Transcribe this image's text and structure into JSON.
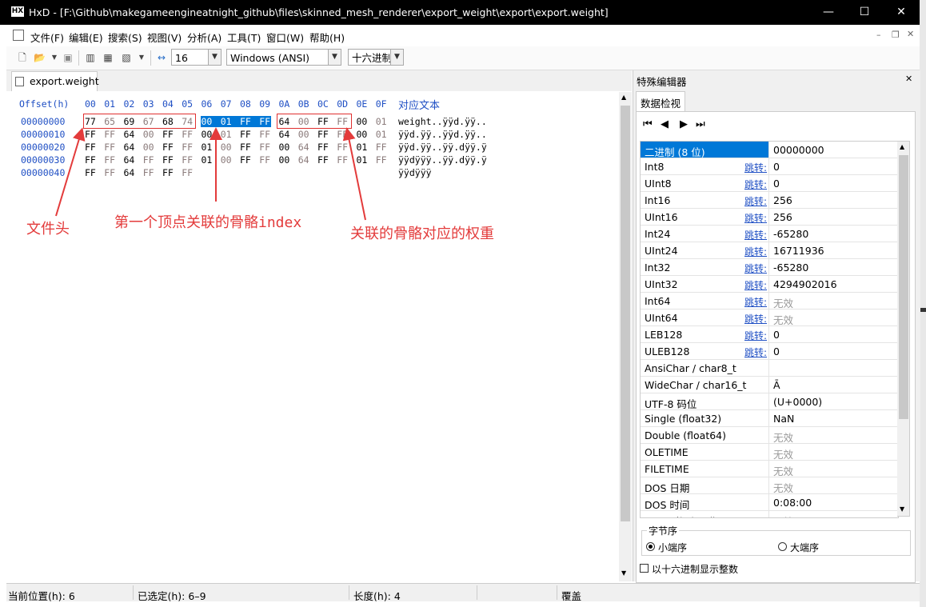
{
  "window": {
    "title": "HxD - [F:\\Github\\makegameengineatnight_github\\files\\skinned_mesh_renderer\\export_weight\\export\\export.weight]",
    "controls": [
      "minimize-icon",
      "maximize-icon",
      "close-icon"
    ]
  },
  "menu": {
    "items": [
      "文件(F)",
      "编辑(E)",
      "搜索(S)",
      "视图(V)",
      "分析(A)",
      "工具(T)",
      "窗口(W)",
      "帮助(H)"
    ]
  },
  "toolbar": {
    "bytes_per_row": "16",
    "charset": "Windows (ANSI)",
    "offset_base": "十六进制"
  },
  "tab": {
    "label": "export.weight"
  },
  "hex": {
    "header_offset": "Offset(h)",
    "columns": [
      "00",
      "01",
      "02",
      "03",
      "04",
      "05",
      "06",
      "07",
      "08",
      "09",
      "0A",
      "0B",
      "0C",
      "0D",
      "0E",
      "0F"
    ],
    "header_text": "对应文本",
    "rows": [
      {
        "offset": "00000000",
        "bytes": [
          "77",
          "65",
          "69",
          "67",
          "68",
          "74",
          "00",
          "01",
          "FF",
          "FF",
          "64",
          "00",
          "FF",
          "FF",
          "00",
          "01"
        ],
        "text": "weight..ÿÿd.ÿÿ.."
      },
      {
        "offset": "00000010",
        "bytes": [
          "FF",
          "FF",
          "64",
          "00",
          "FF",
          "FF",
          "00",
          "01",
          "FF",
          "FF",
          "64",
          "00",
          "FF",
          "FF",
          "00",
          "01"
        ],
        "text": "ÿÿd.ÿÿ..ÿÿd.ÿÿ.."
      },
      {
        "offset": "00000020",
        "bytes": [
          "FF",
          "FF",
          "64",
          "00",
          "FF",
          "FF",
          "01",
          "00",
          "FF",
          "FF",
          "00",
          "64",
          "FF",
          "FF",
          "01",
          "FF"
        ],
        "text": "ÿÿd.ÿÿ..ÿÿ.dÿÿ.ÿ"
      },
      {
        "offset": "00000030",
        "bytes": [
          "FF",
          "FF",
          "64",
          "FF",
          "FF",
          "FF",
          "01",
          "00",
          "FF",
          "FF",
          "00",
          "64",
          "FF",
          "FF",
          "01",
          "FF"
        ],
        "text": "ÿÿdÿÿÿ..ÿÿ.dÿÿ.ÿ"
      },
      {
        "offset": "00000040",
        "bytes": [
          "FF",
          "FF",
          "64",
          "FF",
          "FF",
          "FF"
        ],
        "text": "ÿÿdÿÿÿ"
      }
    ]
  },
  "annotations": {
    "file_header": "文件头",
    "bone_index": "第一个顶点关联的骨骼index",
    "bone_weight": "关联的骨骼对应的权重"
  },
  "panel": {
    "title": "特殊编辑器",
    "tab": "数据检视",
    "jump_label": "跳转:",
    "rows": [
      {
        "key": "二进制 (8 位)",
        "value": "00000000",
        "jump": false,
        "selected": true
      },
      {
        "key": "Int8",
        "value": "0",
        "jump": true
      },
      {
        "key": "UInt8",
        "value": "0",
        "jump": true
      },
      {
        "key": "Int16",
        "value": "256",
        "jump": true
      },
      {
        "key": "UInt16",
        "value": "256",
        "jump": true
      },
      {
        "key": "Int24",
        "value": "-65280",
        "jump": true
      },
      {
        "key": "UInt24",
        "value": "16711936",
        "jump": true
      },
      {
        "key": "Int32",
        "value": "-65280",
        "jump": true
      },
      {
        "key": "UInt32",
        "value": "4294902016",
        "jump": true
      },
      {
        "key": "Int64",
        "value": "无效",
        "jump": true,
        "invalid": true
      },
      {
        "key": "UInt64",
        "value": "无效",
        "jump": true,
        "invalid": true
      },
      {
        "key": "LEB128",
        "value": "0",
        "jump": true
      },
      {
        "key": "ULEB128",
        "value": "0",
        "jump": true
      },
      {
        "key": "AnsiChar / char8_t",
        "value": "",
        "jump": false
      },
      {
        "key": "WideChar / char16_t",
        "value": "Ā",
        "jump": false
      },
      {
        "key": "UTF-8 码位",
        "value": " (U+0000)",
        "jump": false
      },
      {
        "key": "Single (float32)",
        "value": "NaN",
        "jump": false
      },
      {
        "key": "Double (float64)",
        "value": "无效",
        "jump": false,
        "invalid": true
      },
      {
        "key": "OLETIME",
        "value": "无效",
        "jump": false,
        "invalid": true
      },
      {
        "key": "FILETIME",
        "value": "无效",
        "jump": false,
        "invalid": true
      },
      {
        "key": "DOS 日期",
        "value": "无效",
        "jump": false,
        "invalid": true
      },
      {
        "key": "DOS 时间",
        "value": "0:08:00",
        "jump": false
      },
      {
        "key": "DOS 时间与日期",
        "value": "无效",
        "jump": false,
        "invalid": true
      }
    ],
    "byte_order": {
      "legend": "字节序",
      "little": "小端序",
      "big": "大端序",
      "selected": "little"
    },
    "hex_ints_label": "以十六进制显示整数"
  },
  "status": {
    "position": "当前位置(h): 6",
    "selection": "已选定(h): 6–9",
    "length": "长度(h): 4",
    "mode": "覆盖"
  }
}
